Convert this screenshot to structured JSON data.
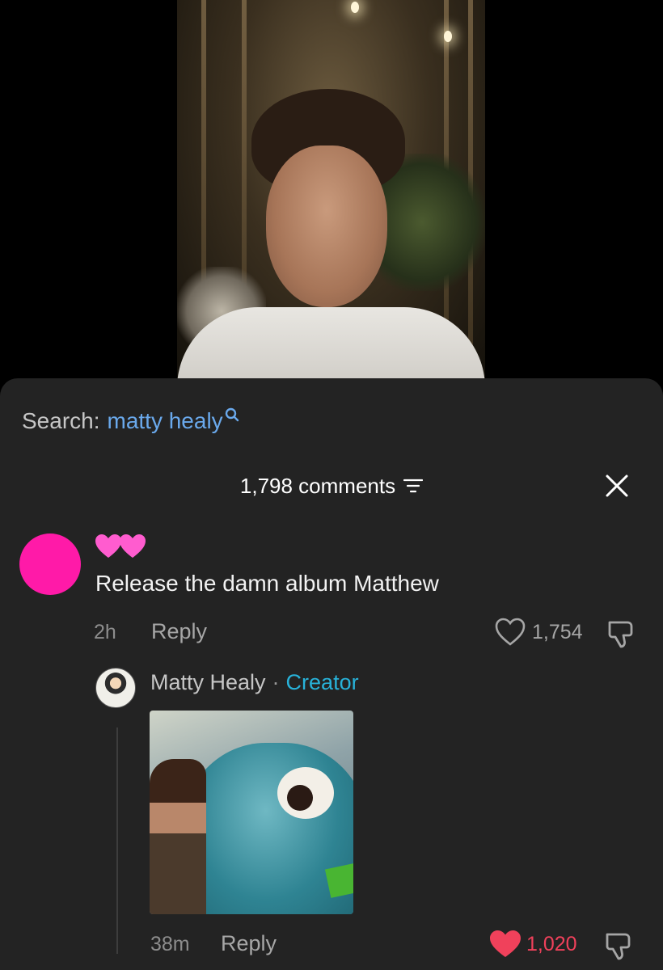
{
  "search": {
    "label": "Search:",
    "query": "matty healy"
  },
  "comments": {
    "count_label": "1,798 comments"
  },
  "comment1": {
    "username_emoji": "💗💗",
    "text": "Release the damn album Matthew",
    "time": "2h",
    "reply_label": "Reply",
    "likes": "1,754",
    "avatar_color": "#ff1aa8"
  },
  "reply1": {
    "author": "Matty Healy",
    "separator": "·",
    "badge": "Creator",
    "time": "38m",
    "reply_label": "Reply",
    "likes": "1,020",
    "liked": true
  },
  "colors": {
    "sheet_bg": "#232323",
    "accent_blue": "#6aa9ec",
    "creator_badge": "#28b2d9",
    "like_red": "#f0415b"
  }
}
